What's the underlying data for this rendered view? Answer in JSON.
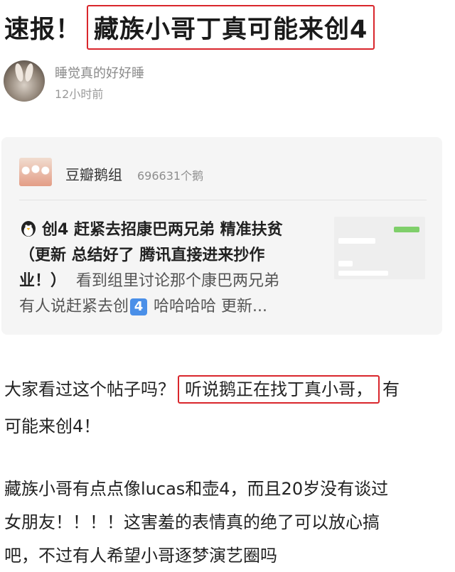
{
  "headline": {
    "prefix": "速报！",
    "boxed": "藏族小哥丁真可能来创4"
  },
  "author": {
    "name": "睡觉真的好好睡",
    "time": "12小时前"
  },
  "shared_post": {
    "group_name": "豆瓣鹅组",
    "member_count": "696631个鹅",
    "title_line1": "创4 赶紧去招康巴两兄弟 精准扶贫",
    "title_line2": "（更新 总结好了 腾讯直接进来抄作",
    "title_line3_strong": "业！）",
    "title_line3_rest": "看到组里讨论那个康巴两兄弟",
    "line4_before": "有人说赶紧去创",
    "line4_badge": "4",
    "line4_after": "哈哈哈哈 更新..."
  },
  "body": {
    "p1_before": "大家看过这个帖子吗？",
    "p1_boxed": "听说鹅正在找丁真小哥，",
    "p1_after": "有",
    "p2": "可能来创4！",
    "p3": "藏族小哥有点点像lucas和壶4，而且20岁没有谈过",
    "p4": "女朋友！！！！这害羞的表情真的绝了可以放心搞",
    "p5": "吧，不过有人希望小哥逐梦演艺圈吗"
  },
  "colors": {
    "highlight_box": "#d9262c",
    "card_bg": "#f5f5f5",
    "badge_blue": "#4a8fe8"
  }
}
